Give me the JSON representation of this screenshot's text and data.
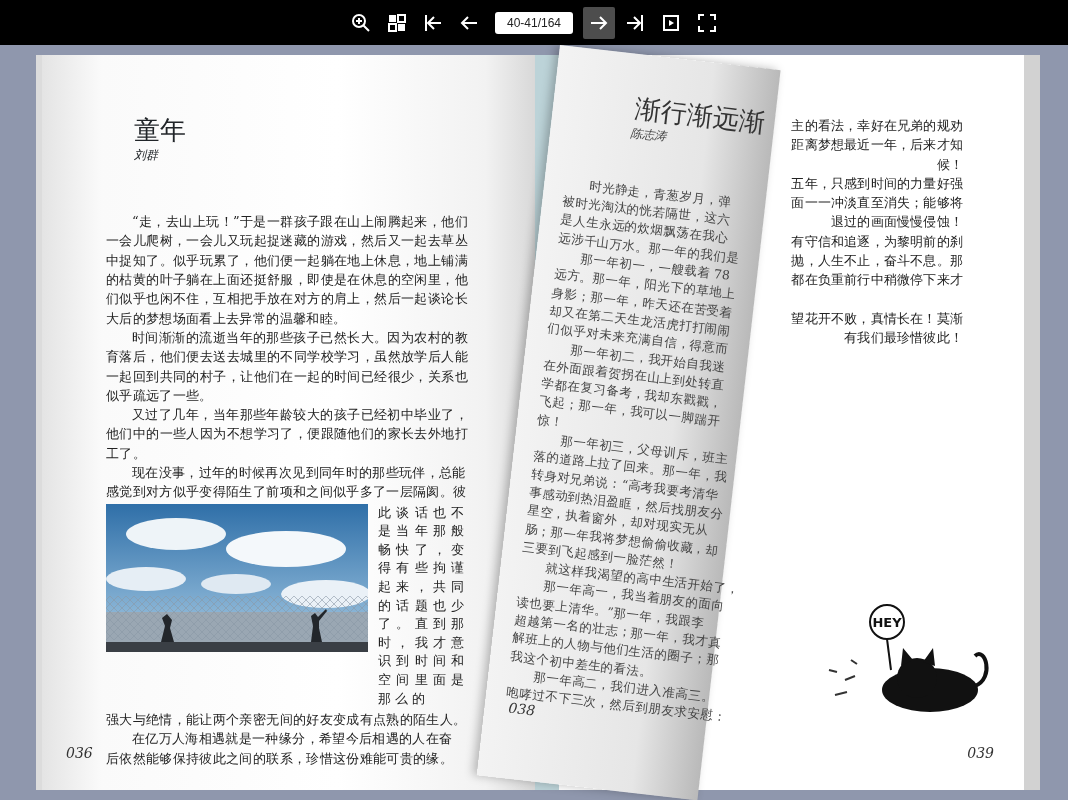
{
  "toolbar": {
    "items": [
      {
        "kind": "zoom-in",
        "highlighted": false
      },
      {
        "kind": "thumbnails",
        "highlighted": false
      },
      {
        "kind": "first",
        "highlighted": false
      },
      {
        "kind": "prev",
        "highlighted": false
      },
      {
        "kind": "page-field",
        "value": "40-41/164"
      },
      {
        "kind": "next",
        "highlighted": true
      },
      {
        "kind": "last",
        "highlighted": false
      },
      {
        "kind": "autoplay",
        "highlighted": false
      },
      {
        "kind": "fullscreen",
        "highlighted": false
      }
    ]
  },
  "left_page": {
    "title": "童年",
    "author": "刘群",
    "paragraphs": [
      {
        "text": "“走，去山上玩！”于是一群孩子跟在山上闹腾起来，他们一会儿爬树，一会儿又玩起捉迷藏的游戏，然后又一起去草丛中捉知了。似乎玩累了，他们便一起躺在地上休息，地上铺满的枯黄的叶子躺在上面还挺舒服，即使是在休息的空闲里，他们似乎也闲不住，互相把手放在对方的肩上，然后一起谈论长大后的梦想场面看上去异常的温馨和睦。"
      },
      {
        "text": "时间渐渐的流逝当年的那些孩子已然长大。因为农村的教育落后，他们便去送去城里的不同学校学习，虽然放学后人能一起回到共同的村子，让他们在一起的时间已经很少，关系也似乎疏远了一些。"
      },
      {
        "text": "又过了几年，当年那些年龄较大的孩子已经初中毕业了，他们中的一些人因为不想学习了，便跟随他们的家长去外地打工了。"
      },
      {
        "lines": [
          "现在没事，过年的时候再次见到同年时的那些玩伴，总能",
          "感觉到对方似乎变得陌生了前项和之间似乎多了一层隔阂。彼"
        ],
        "figure": {
          "kind": "picture"
        },
        "beside": "此谈话也不是当年那般畅快了，变得有些拘谨起来，共同的话题也少了。直到那时，我才意识到时间和空间里面是那么的",
        "lines_after": [
          "强大与绝情，能让两个亲密无间的好友变成有点熟的陌生人。"
        ]
      },
      {
        "lines": [
          "在亿万人海相遇就是一种缘分，希望今后相遇的人在奋",
          "后依然能够保持彼此之间的联系，珍惜这份难能可贵的缘。"
        ]
      }
    ],
    "page_number": "036"
  },
  "turning_page": {
    "title": "渐行渐远渐",
    "author": "陈志涛",
    "paragraphs": [
      {
        "lines": [
          "时光静走，青葱岁月，弹",
          "被时光淘汰的恍若隔世，这六",
          "是人生永远的炊烟飘荡在我心",
          "远涉千山万水。那一年的我们是"
        ]
      },
      {
        "lines": [
          "那一年初一，一艘载着 78",
          "远方。那一年，阳光下的草地上",
          "身影；那一年，昨天还在苦受着",
          "却又在第二天生龙活虎打打闹闹",
          "们似乎对未来充满自信，得意而"
        ]
      },
      {
        "lines": [
          "那一年初二，我开始自我迷",
          "在外面跟着贺拐在山上到处转直",
          "学都在复习备考，我却东戳戳，",
          "飞起；那一年，我可以一脚踹开",
          "惊！"
        ]
      },
      {
        "lines": [
          "那一年初三，父母训斥，班主",
          "落的道路上拉了回来。那一年，我",
          "转身对兄弟说：“高考我要考清华",
          "事感动到热泪盈眶，然后找朋友分",
          "星空，执着窗外，却对现实无从",
          "肠；那一年我将梦想偷偷收藏，却",
          "三要到飞起感到一脸茫然！"
        ]
      },
      {
        "lines": [
          "就这样我渴望的高中生活开始了，"
        ]
      },
      {
        "lines": [
          "那一年高一，我当着朋友的面向",
          "读也要上清华。”那一年，我跟李",
          "超越第一名的壮志；那一年，我才真",
          "解班上的人物与他们生活的圈子；那",
          "我这个初中差生的看法。"
        ]
      },
      {
        "lines": [
          "那一年高二，我们进入准高三。",
          "咆哮过不下三次，然后到朋友求安慰："
        ]
      }
    ],
    "page_number": "038"
  },
  "right_page": {
    "groups": [
      {
        "lines": [
          "主的看法，幸好在兄弟的规劝",
          "距离梦想最近一年，后来才知",
          "候！",
          "五年，只感到时间的力量好强",
          "面一一冲淡直至消失；能够将",
          "退过的画面慢慢侵蚀！",
          "有守信和追逐，为黎明前的刹",
          "抛，人生不止，奋斗不息。那",
          "都在负重前行中稍微停下来才"
        ]
      },
      {
        "lines": [
          "望花开不败，真情长在！莫渐",
          "有我们最珍惜彼此！"
        ]
      }
    ],
    "illustration": {
      "sign": "HEY"
    },
    "page_number": "039"
  }
}
